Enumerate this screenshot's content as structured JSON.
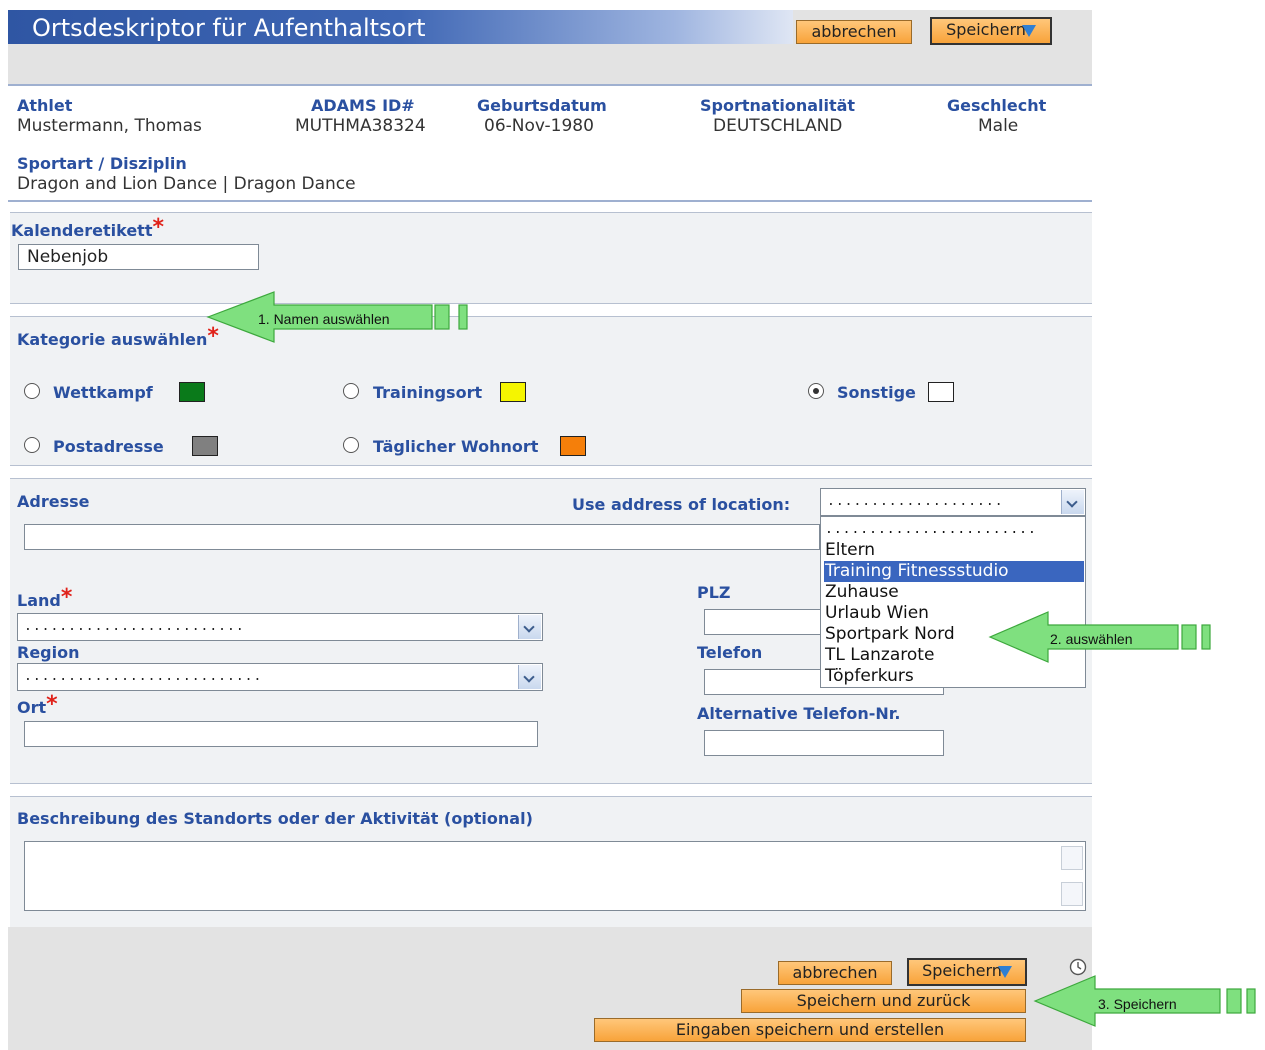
{
  "window": {
    "title": "Ortsdeskriptor für Aufenthaltsort"
  },
  "toolbar": {
    "cancel_label": "abbrechen",
    "save_label": "Speichern"
  },
  "athlete": {
    "athlet_label": "Athlet",
    "athlet_value": "Mustermann, Thomas",
    "adams_label": "ADAMS ID#",
    "adams_value": "MUTHMA38324",
    "birth_label": "Geburtsdatum",
    "birth_value": "06-Nov-1980",
    "nation_label": "Sportnationalität",
    "nation_value": "DEUTSCHLAND",
    "gender_label": "Geschlecht",
    "gender_value": "Male",
    "sport_label": "Sportart / Disziplin",
    "sport_value": "Dragon and Lion Dance | Dragon Dance"
  },
  "calendar": {
    "label": "Kalenderetikett",
    "value": "Nebenjob"
  },
  "category": {
    "label": "Kategorie auswählen",
    "options": [
      {
        "label": "Wettkampf",
        "color": "#0a7a1a",
        "selected": false
      },
      {
        "label": "Trainingsort",
        "color": "#f5f500",
        "selected": false
      },
      {
        "label": "Sonstige",
        "color": "#ffffff",
        "selected": true
      },
      {
        "label": "Postadresse",
        "color": "#808080",
        "selected": false
      },
      {
        "label": "Täglicher Wohnort",
        "color": "#f57f0a",
        "selected": false
      }
    ]
  },
  "address": {
    "label": "Adresse",
    "use_location_label": "Use address of location:",
    "use_location_value": "....................",
    "dropdown_options": [
      "........................",
      "Eltern",
      "Training Fitnessstudio",
      "Zuhause",
      "Urlaub Wien",
      "Sportpark Nord",
      "TL Lanzarote",
      "Töpferkurs"
    ],
    "dropdown_selected": "Training Fitnessstudio",
    "land_label": "Land",
    "land_value": ".........................",
    "region_label": "Region",
    "region_value": "...........................",
    "ort_label": "Ort",
    "plz_label": "PLZ",
    "telefon_label": "Telefon",
    "alt_telefon_label": "Alternative Telefon-Nr."
  },
  "description": {
    "label": "Beschreibung des Standorts oder der Aktivität (optional)"
  },
  "footer": {
    "cancel_label": "abbrechen",
    "save_label": "Speichern",
    "save_back_label": "Speichern und zurück",
    "save_create_label": "Eingaben speichern und erstellen"
  },
  "annotations": {
    "step1": "1. Namen auswählen",
    "step2": "2. auswählen",
    "step3": "3. Speichern",
    "arrow_color": "#7fe07f"
  }
}
